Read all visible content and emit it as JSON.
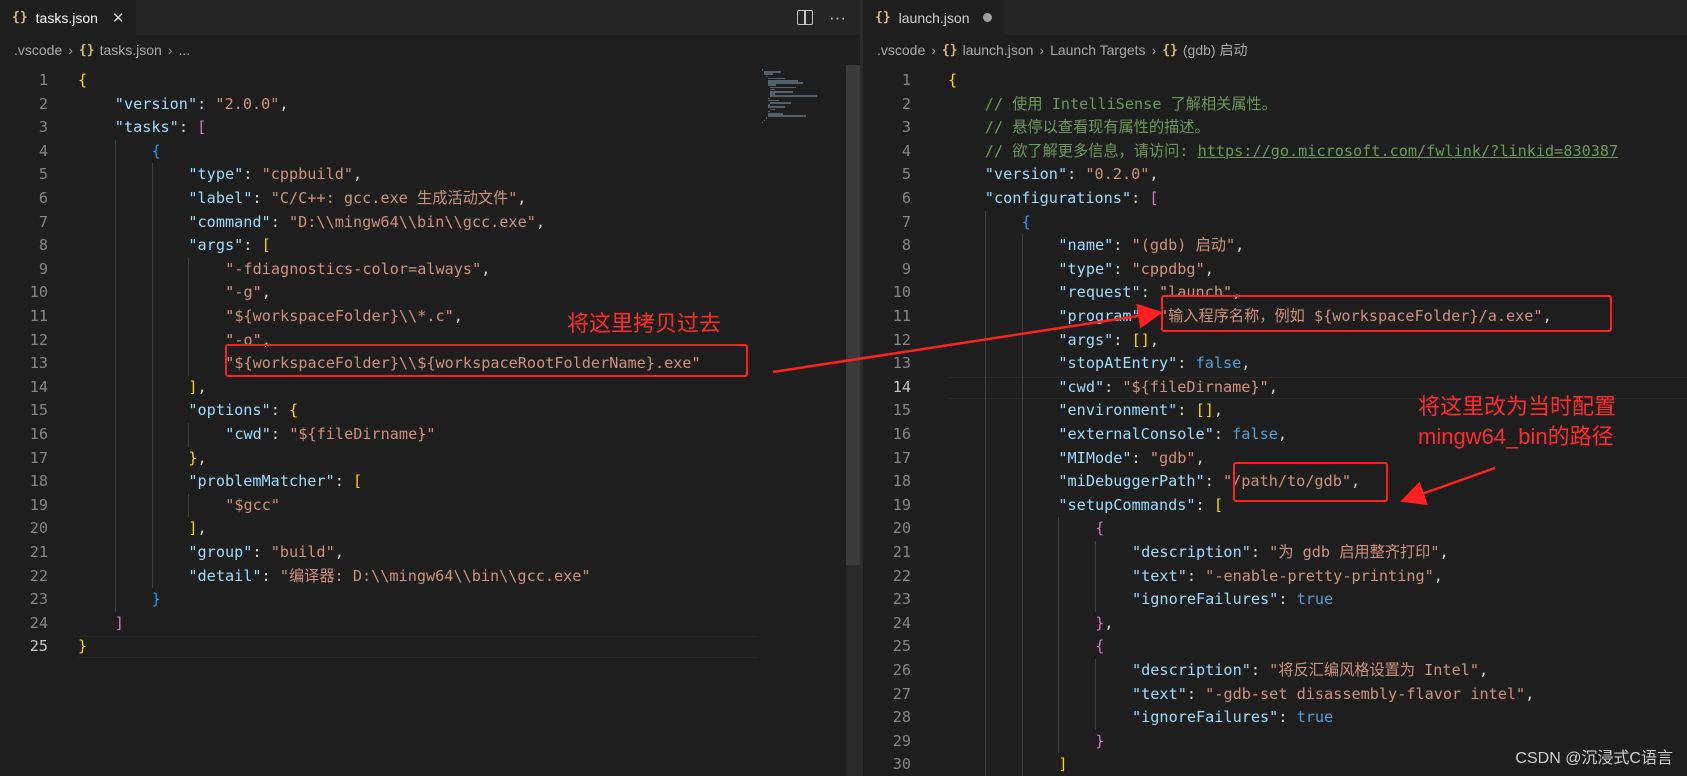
{
  "left_editor": {
    "tab": {
      "icon": "json-braces-icon",
      "label": "tasks.json",
      "close": "✕"
    },
    "breadcrumb": [
      ".vscode",
      "tasks.json",
      "..."
    ],
    "lines": [
      {
        "n": "1",
        "indent": 0,
        "tokens": [
          [
            "br1",
            "{"
          ]
        ]
      },
      {
        "n": "2",
        "indent": 1,
        "tokens": [
          [
            "k",
            "\"version\""
          ],
          [
            "p",
            ": "
          ],
          [
            "s",
            "\"2.0.0\""
          ],
          [
            "p",
            ","
          ]
        ]
      },
      {
        "n": "3",
        "indent": 1,
        "tokens": [
          [
            "k",
            "\"tasks\""
          ],
          [
            "p",
            ": "
          ],
          [
            "br2",
            "["
          ]
        ]
      },
      {
        "n": "4",
        "indent": 2,
        "tokens": [
          [
            "br3",
            "{"
          ]
        ]
      },
      {
        "n": "5",
        "indent": 3,
        "tokens": [
          [
            "k",
            "\"type\""
          ],
          [
            "p",
            ": "
          ],
          [
            "s",
            "\"cppbuild\""
          ],
          [
            "p",
            ","
          ]
        ]
      },
      {
        "n": "6",
        "indent": 3,
        "tokens": [
          [
            "k",
            "\"label\""
          ],
          [
            "p",
            ": "
          ],
          [
            "s",
            "\"C/C++: gcc.exe 生成活动文件\""
          ],
          [
            "p",
            ","
          ]
        ]
      },
      {
        "n": "7",
        "indent": 3,
        "tokens": [
          [
            "k",
            "\"command\""
          ],
          [
            "p",
            ": "
          ],
          [
            "s",
            "\"D:\\\\mingw64\\\\bin\\\\gcc.exe\""
          ],
          [
            "p",
            ","
          ]
        ]
      },
      {
        "n": "8",
        "indent": 3,
        "tokens": [
          [
            "k",
            "\"args\""
          ],
          [
            "p",
            ": "
          ],
          [
            "br1",
            "["
          ]
        ]
      },
      {
        "n": "9",
        "indent": 4,
        "tokens": [
          [
            "s",
            "\"-fdiagnostics-color=always\""
          ],
          [
            "p",
            ","
          ]
        ]
      },
      {
        "n": "10",
        "indent": 4,
        "tokens": [
          [
            "s",
            "\"-g\""
          ],
          [
            "p",
            ","
          ]
        ]
      },
      {
        "n": "11",
        "indent": 4,
        "tokens": [
          [
            "s",
            "\"${workspaceFolder}\\\\*.c\""
          ],
          [
            "p",
            ","
          ]
        ]
      },
      {
        "n": "12",
        "indent": 4,
        "tokens": [
          [
            "s",
            "\"-o\""
          ],
          [
            "p",
            ","
          ]
        ]
      },
      {
        "n": "13",
        "indent": 4,
        "tokens": [
          [
            "s",
            "\"${workspaceFolder}\\\\${workspaceRootFolderName}.exe\""
          ]
        ]
      },
      {
        "n": "14",
        "indent": 3,
        "tokens": [
          [
            "br1",
            "]"
          ],
          [
            "p",
            ","
          ]
        ]
      },
      {
        "n": "15",
        "indent": 3,
        "tokens": [
          [
            "k",
            "\"options\""
          ],
          [
            "p",
            ": "
          ],
          [
            "br1",
            "{"
          ]
        ]
      },
      {
        "n": "16",
        "indent": 4,
        "tokens": [
          [
            "k",
            "\"cwd\""
          ],
          [
            "p",
            ": "
          ],
          [
            "s",
            "\"${fileDirname}\""
          ]
        ]
      },
      {
        "n": "17",
        "indent": 3,
        "tokens": [
          [
            "br1",
            "}"
          ],
          [
            "p",
            ","
          ]
        ]
      },
      {
        "n": "18",
        "indent": 3,
        "tokens": [
          [
            "k",
            "\"problemMatcher\""
          ],
          [
            "p",
            ": "
          ],
          [
            "br1",
            "["
          ]
        ]
      },
      {
        "n": "19",
        "indent": 4,
        "tokens": [
          [
            "s",
            "\"$gcc\""
          ]
        ]
      },
      {
        "n": "20",
        "indent": 3,
        "tokens": [
          [
            "br1",
            "]"
          ],
          [
            "p",
            ","
          ]
        ]
      },
      {
        "n": "21",
        "indent": 3,
        "tokens": [
          [
            "k",
            "\"group\""
          ],
          [
            "p",
            ": "
          ],
          [
            "s",
            "\"build\""
          ],
          [
            "p",
            ","
          ]
        ]
      },
      {
        "n": "22",
        "indent": 3,
        "tokens": [
          [
            "k",
            "\"detail\""
          ],
          [
            "p",
            ": "
          ],
          [
            "s",
            "\"编译器: D:\\\\mingw64\\\\bin\\\\gcc.exe\""
          ]
        ]
      },
      {
        "n": "23",
        "indent": 2,
        "tokens": [
          [
            "br3",
            "}"
          ]
        ]
      },
      {
        "n": "24",
        "indent": 1,
        "tokens": [
          [
            "br2",
            "]"
          ]
        ]
      },
      {
        "n": "25",
        "indent": 0,
        "tokens": [
          [
            "br1",
            "}"
          ]
        ],
        "active": true
      }
    ]
  },
  "right_editor": {
    "tab": {
      "icon": "json-braces-icon",
      "label": "launch.json",
      "modified_dot": true
    },
    "breadcrumb": [
      ".vscode",
      "launch.json",
      "Launch Targets",
      "(gdb) 启动"
    ],
    "lines": [
      {
        "n": "1",
        "indent": 0,
        "tokens": [
          [
            "br1",
            "{"
          ]
        ]
      },
      {
        "n": "2",
        "indent": 1,
        "tokens": [
          [
            "c",
            "// 使用 IntelliSense 了解相关属性。"
          ]
        ]
      },
      {
        "n": "3",
        "indent": 1,
        "tokens": [
          [
            "c",
            "// 悬停以查看现有属性的描述。"
          ]
        ]
      },
      {
        "n": "4",
        "indent": 1,
        "tokens": [
          [
            "c",
            "// 欲了解更多信息，请访问: "
          ],
          [
            "link",
            "https://go.microsoft.com/fwlink/?linkid=830387"
          ]
        ]
      },
      {
        "n": "5",
        "indent": 1,
        "tokens": [
          [
            "k",
            "\"version\""
          ],
          [
            "p",
            ": "
          ],
          [
            "s",
            "\"0.2.0\""
          ],
          [
            "p",
            ","
          ]
        ]
      },
      {
        "n": "6",
        "indent": 1,
        "tokens": [
          [
            "k",
            "\"configurations\""
          ],
          [
            "p",
            ": "
          ],
          [
            "br2",
            "["
          ]
        ]
      },
      {
        "n": "7",
        "indent": 2,
        "tokens": [
          [
            "br3",
            "{"
          ]
        ]
      },
      {
        "n": "8",
        "indent": 3,
        "tokens": [
          [
            "k",
            "\"name\""
          ],
          [
            "p",
            ": "
          ],
          [
            "s",
            "\"(gdb) 启动\""
          ],
          [
            "p",
            ","
          ]
        ]
      },
      {
        "n": "9",
        "indent": 3,
        "tokens": [
          [
            "k",
            "\"type\""
          ],
          [
            "p",
            ": "
          ],
          [
            "s",
            "\"cppdbg\""
          ],
          [
            "p",
            ","
          ]
        ]
      },
      {
        "n": "10",
        "indent": 3,
        "tokens": [
          [
            "k",
            "\"request\""
          ],
          [
            "p",
            ": "
          ],
          [
            "s",
            "\"launch\""
          ],
          [
            "p",
            ","
          ]
        ]
      },
      {
        "n": "11",
        "indent": 3,
        "tokens": [
          [
            "k",
            "\"program\""
          ],
          [
            "p",
            ": "
          ],
          [
            "s",
            "\"输入程序名称，例如 ${workspaceFolder}/a.exe\""
          ],
          [
            "p",
            ","
          ]
        ]
      },
      {
        "n": "12",
        "indent": 3,
        "tokens": [
          [
            "k",
            "\"args\""
          ],
          [
            "p",
            ": "
          ],
          [
            "br1",
            "[]"
          ],
          [
            "p",
            ","
          ]
        ]
      },
      {
        "n": "13",
        "indent": 3,
        "tokens": [
          [
            "k",
            "\"stopAtEntry\""
          ],
          [
            "p",
            ": "
          ],
          [
            "b",
            "false"
          ],
          [
            "p",
            ","
          ]
        ]
      },
      {
        "n": "14",
        "indent": 3,
        "tokens": [
          [
            "k",
            "\"cwd\""
          ],
          [
            "p",
            ": "
          ],
          [
            "s",
            "\"${fileDirname}\""
          ],
          [
            "p",
            ","
          ]
        ],
        "active": true
      },
      {
        "n": "15",
        "indent": 3,
        "tokens": [
          [
            "k",
            "\"environment\""
          ],
          [
            "p",
            ": "
          ],
          [
            "br1",
            "[]"
          ],
          [
            "p",
            ","
          ]
        ]
      },
      {
        "n": "16",
        "indent": 3,
        "tokens": [
          [
            "k",
            "\"externalConsole\""
          ],
          [
            "p",
            ": "
          ],
          [
            "b",
            "false"
          ],
          [
            "p",
            ","
          ]
        ]
      },
      {
        "n": "17",
        "indent": 3,
        "tokens": [
          [
            "k",
            "\"MIMode\""
          ],
          [
            "p",
            ": "
          ],
          [
            "s",
            "\"gdb\""
          ],
          [
            "p",
            ","
          ]
        ]
      },
      {
        "n": "18",
        "indent": 3,
        "tokens": [
          [
            "k",
            "\"miDebuggerPath\""
          ],
          [
            "p",
            ": "
          ],
          [
            "s",
            "\"/path/to/gdb\""
          ],
          [
            "p",
            ","
          ]
        ]
      },
      {
        "n": "19",
        "indent": 3,
        "tokens": [
          [
            "k",
            "\"setupCommands\""
          ],
          [
            "p",
            ": "
          ],
          [
            "br1",
            "["
          ]
        ]
      },
      {
        "n": "20",
        "indent": 4,
        "tokens": [
          [
            "br2",
            "{"
          ]
        ]
      },
      {
        "n": "21",
        "indent": 5,
        "tokens": [
          [
            "k",
            "\"description\""
          ],
          [
            "p",
            ": "
          ],
          [
            "s",
            "\"为 gdb 启用整齐打印\""
          ],
          [
            "p",
            ","
          ]
        ]
      },
      {
        "n": "22",
        "indent": 5,
        "tokens": [
          [
            "k",
            "\"text\""
          ],
          [
            "p",
            ": "
          ],
          [
            "s",
            "\"-enable-pretty-printing\""
          ],
          [
            "p",
            ","
          ]
        ]
      },
      {
        "n": "23",
        "indent": 5,
        "tokens": [
          [
            "k",
            "\"ignoreFailures\""
          ],
          [
            "p",
            ": "
          ],
          [
            "b",
            "true"
          ]
        ]
      },
      {
        "n": "24",
        "indent": 4,
        "tokens": [
          [
            "br2",
            "}"
          ],
          [
            "p",
            ","
          ]
        ]
      },
      {
        "n": "25",
        "indent": 4,
        "tokens": [
          [
            "br2",
            "{"
          ]
        ]
      },
      {
        "n": "26",
        "indent": 5,
        "tokens": [
          [
            "k",
            "\"description\""
          ],
          [
            "p",
            ": "
          ],
          [
            "s",
            "\"将反汇编风格设置为 Intel\""
          ],
          [
            "p",
            ","
          ]
        ]
      },
      {
        "n": "27",
        "indent": 5,
        "tokens": [
          [
            "k",
            "\"text\""
          ],
          [
            "p",
            ": "
          ],
          [
            "s",
            "\"-gdb-set disassembly-flavor intel\""
          ],
          [
            "p",
            ","
          ]
        ]
      },
      {
        "n": "28",
        "indent": 5,
        "tokens": [
          [
            "k",
            "\"ignoreFailures\""
          ],
          [
            "p",
            ": "
          ],
          [
            "b",
            "true"
          ]
        ]
      },
      {
        "n": "29",
        "indent": 4,
        "tokens": [
          [
            "br2",
            "}"
          ]
        ]
      },
      {
        "n": "30",
        "indent": 3,
        "tokens": [
          [
            "br1",
            "]"
          ]
        ]
      }
    ]
  },
  "annotations": {
    "copy_note": "将这里拷贝过去",
    "path_note_line1": "将这里改为当时配置",
    "path_note_line2": "mingw64_bin的路径",
    "color": "#ff2020"
  },
  "watermark": "CSDN @沉浸式C语言",
  "colors": {
    "background": "#1e1e1e",
    "key": "#9cdcfe",
    "string": "#ce9178",
    "keyword": "#569cd6",
    "comment": "#6a9955"
  }
}
